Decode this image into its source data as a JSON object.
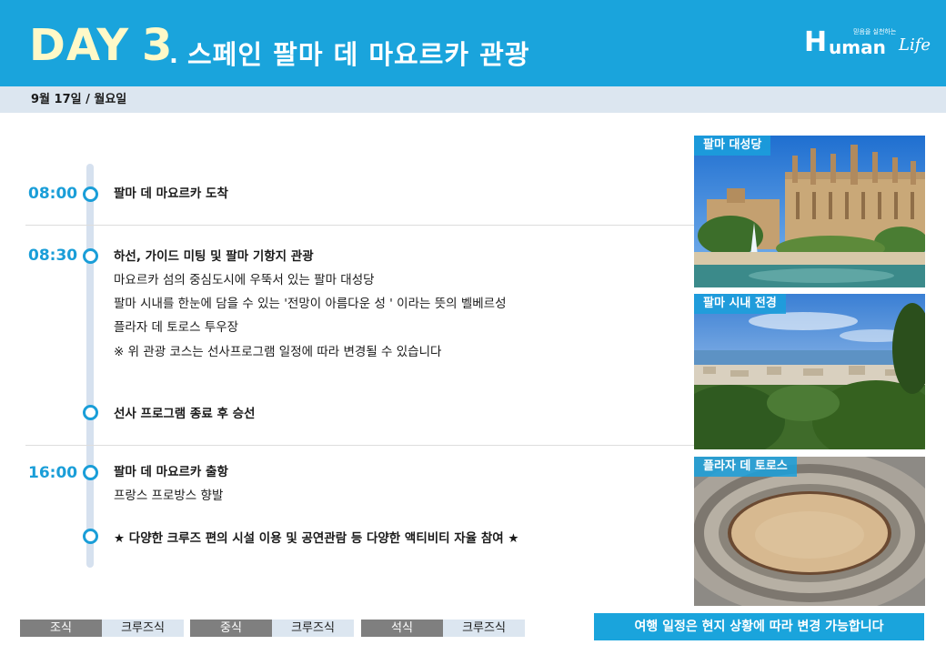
{
  "header": {
    "day_word": "DAY",
    "day_number": "3",
    "dot": ".",
    "title": "스페인 팔마 데 마요르카 관광",
    "logo": {
      "tagline": "믿음을 실천하는",
      "h": "H",
      "uman": "uman",
      "life": "Life"
    }
  },
  "date": "9월 17일 / 월요일",
  "schedule": [
    {
      "time": "08:00",
      "lines": [
        "팔마 데 마요르카 도착"
      ]
    },
    {
      "time": "08:30",
      "lines": [
        "하선, 가이드 미팅 및 팔마 기항지 관광",
        "마요르카 섬의 중심도시에 우뚝서 있는 팔마 대성당",
        "팔마 시내를 한눈에 담을 수 있는 '전망이 아름다운 성 ' 이라는 뜻의 벨베르성",
        "플라자 데 토로스 투우장",
        "※ 위 관광 코스는 선사프로그램 일정에 따라 변경될 수 있습니다"
      ]
    },
    {
      "time": "",
      "lines": [
        "선사 프로그램 종료 후 승선"
      ]
    },
    {
      "time": "16:00",
      "lines": [
        "팔마 데 마요르카 출항",
        "프랑스 프로방스 향발"
      ]
    },
    {
      "time": "",
      "lines": [
        "★ 다양한 크루즈 편의 시설 이용 및 공연관람 등 다양한 액티비티 자율 참여 ★"
      ]
    }
  ],
  "photos": [
    {
      "caption": "팔마 대성당"
    },
    {
      "caption": "팔마 시내 전경"
    },
    {
      "caption": "플라자 데 토로스"
    }
  ],
  "meals": [
    {
      "label": "조식",
      "value": "크루즈식"
    },
    {
      "label": "중식",
      "value": "크루즈식"
    },
    {
      "label": "석식",
      "value": "크루즈식"
    }
  ],
  "notice": "여행 일정은 현지 상황에 따라 변경 가능합니다",
  "colors": {
    "header_blue": "#1aa4dc",
    "title_yellow": "#fff9c8",
    "time_blue": "#1a9ed8",
    "date_bar": "#dce6f0",
    "meal_label_gray": "#7f7f7f"
  }
}
